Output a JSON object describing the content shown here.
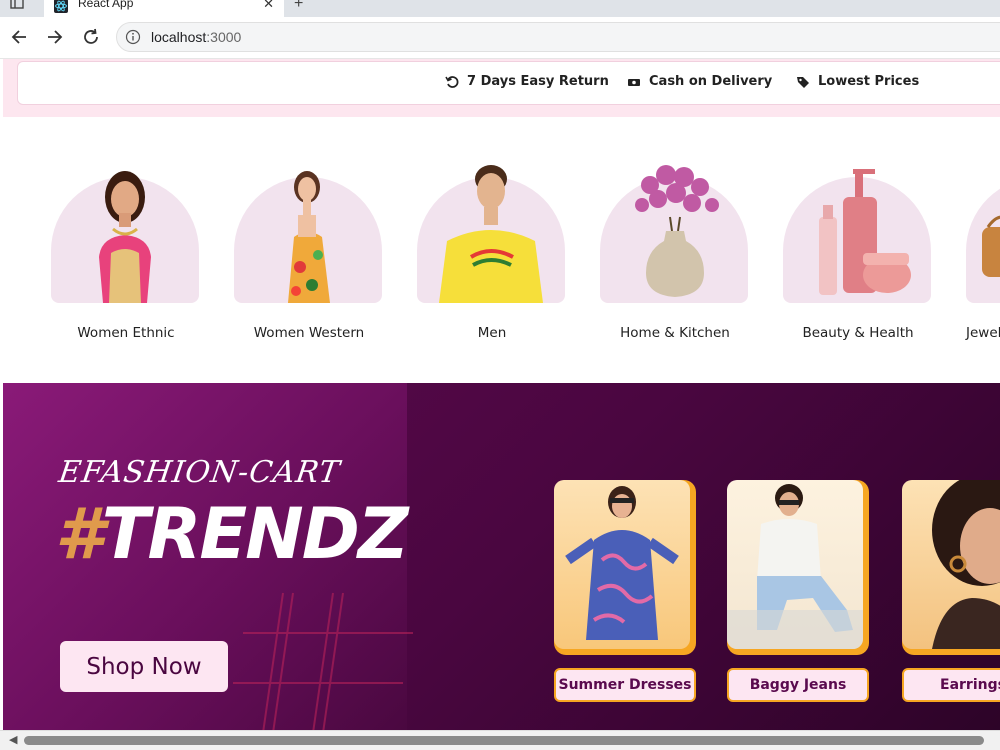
{
  "browser": {
    "tab_title": "React App",
    "tab_close": "✕",
    "new_tab": "+",
    "url_host": "localhost",
    "url_port": ":3000"
  },
  "promo_bar": {
    "items": [
      {
        "label": "7 Days Easy Return",
        "icon": "return-icon"
      },
      {
        "label": "Cash on Delivery",
        "icon": "cash-icon"
      },
      {
        "label": "Lowest Prices",
        "icon": "tag-icon"
      }
    ]
  },
  "categories": [
    {
      "label": "Women Ethnic"
    },
    {
      "label": "Women Western"
    },
    {
      "label": "Men"
    },
    {
      "label": "Home & Kitchen"
    },
    {
      "label": "Beauty & Health"
    },
    {
      "label": "Jewel"
    }
  ],
  "banner": {
    "brand_top": "EFASHION-CART",
    "brand_hash": "#",
    "brand_main": "TRENDZ",
    "shop_button": "Shop Now",
    "trends": [
      {
        "label": "Summer Dresses"
      },
      {
        "label": "Baggy Jeans"
      },
      {
        "label": "Earrings"
      }
    ]
  },
  "colors": {
    "banner_bg": "#4a0640",
    "accent_orange": "#f6a622",
    "pill_bg": "#fde6f2",
    "arch_bg": "#f2e3ee"
  }
}
